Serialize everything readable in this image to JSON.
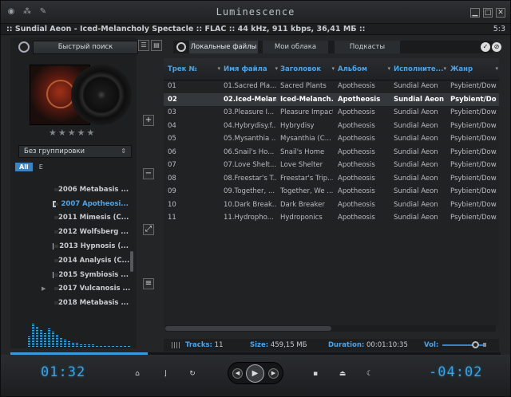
{
  "window": {
    "app_title": "Luminescence",
    "info_line": ":: Sundial Aeon - Iced-Melancholy Spectacle :: FLAC :: 44 kHz, 911 kbps, 36,41 МБ ::",
    "info_time": "5:3",
    "controls": [
      "minimize",
      "maximize",
      "close"
    ]
  },
  "left": {
    "search_label": "Быстрый поиск",
    "group_select": "Без группировки",
    "letters": [
      "All",
      "E"
    ],
    "tree": [
      {
        "label": "2006 Metabasis ...",
        "selected": false,
        "expander": false
      },
      {
        "label": "2007 Apotheosi...",
        "selected": true,
        "expander": false
      },
      {
        "label": "2011 Mimesis (C...",
        "selected": false,
        "expander": false
      },
      {
        "label": "2012 Wolfsberg ...",
        "selected": false,
        "expander": false
      },
      {
        "label": "2013 Hypnosis (...",
        "selected": false,
        "expander": false
      },
      {
        "label": "2014 Analysis (C...",
        "selected": false,
        "expander": false
      },
      {
        "label": "2015 Symbiosis ...",
        "selected": false,
        "expander": false
      },
      {
        "label": "2017 Vulcanosis ...",
        "selected": false,
        "expander": true
      },
      {
        "label": "2018 Metabasis ...",
        "selected": false,
        "expander": false
      }
    ],
    "rating_stars": 5,
    "side_buttons": [
      "+",
      "−",
      "⤢",
      "≡"
    ]
  },
  "tabs": [
    {
      "label": "Локальные файлы",
      "active": true
    },
    {
      "label": "Мои облака",
      "active": false
    },
    {
      "label": "Подкасты",
      "active": false
    }
  ],
  "table": {
    "columns": [
      "Трек №",
      "Имя файла",
      "Заголовок",
      "Альбом",
      "Исполните...",
      "Жанр"
    ],
    "rows": [
      [
        "01",
        "01.Sacred Pla...",
        "Sacred Plants",
        "Apotheosis",
        "Sundial Aeon",
        "Psybient/Dow..."
      ],
      [
        "02",
        "02.Iced-Melan...",
        "Iced-Melanch...",
        "Apotheosis",
        "Sundial Aeon",
        "Psybient/Dow..."
      ],
      [
        "03",
        "03.Pleasure I...",
        "Pleasure Impact",
        "Apotheosis",
        "Sundial Aeon",
        "Psybient/Dow..."
      ],
      [
        "04",
        "04.Hybrydisy.f...",
        "Hybrydisy",
        "Apotheosis",
        "Sundial Aeon",
        "Psybient/Dow..."
      ],
      [
        "05",
        "05.Mysanthia ...",
        "Mysanthia (C...",
        "Apotheosis",
        "Sundial Aeon",
        "Psybient/Dow..."
      ],
      [
        "06",
        "06.Snail's Ho...",
        "Snail's Home",
        "Apotheosis",
        "Sundial Aeon",
        "Psybient/Dow..."
      ],
      [
        "07",
        "07.Love Shelt...",
        "Love Shelter",
        "Apotheosis",
        "Sundial Aeon",
        "Psybient/Dow..."
      ],
      [
        "08",
        "08.Freestar's T...",
        "Freestar's Trip...",
        "Apotheosis",
        "Sundial Aeon",
        "Psybient/Dow..."
      ],
      [
        "09",
        "09.Together, ...",
        "Together, We ...",
        "Apotheosis",
        "Sundial Aeon",
        "Psybient/Dow..."
      ],
      [
        "10",
        "10.Dark Break...",
        "Dark Breaker",
        "Apotheosis",
        "Sundial Aeon",
        "Psybient/Dow..."
      ],
      [
        "11",
        "11.Hydropho...",
        "Hydroponics",
        "Apotheosis",
        "Sundial Aeon",
        "Psybient/Dow..."
      ]
    ],
    "selected_row": 1
  },
  "status": {
    "tracks_label": "Tracks:",
    "tracks_value": "11",
    "size_label": "Size:",
    "size_value": "459,15 МБ",
    "duration_label": "Duration:",
    "duration_value": "00:01:10:35",
    "vol_label": "Vol:",
    "volume": 0.75
  },
  "player": {
    "elapsed": "01:32",
    "remaining": "-04:02",
    "progress": 0.28
  },
  "colors": {
    "accent": "#4ea3e6",
    "lcd": "#3da2e0",
    "background": "#232527"
  }
}
